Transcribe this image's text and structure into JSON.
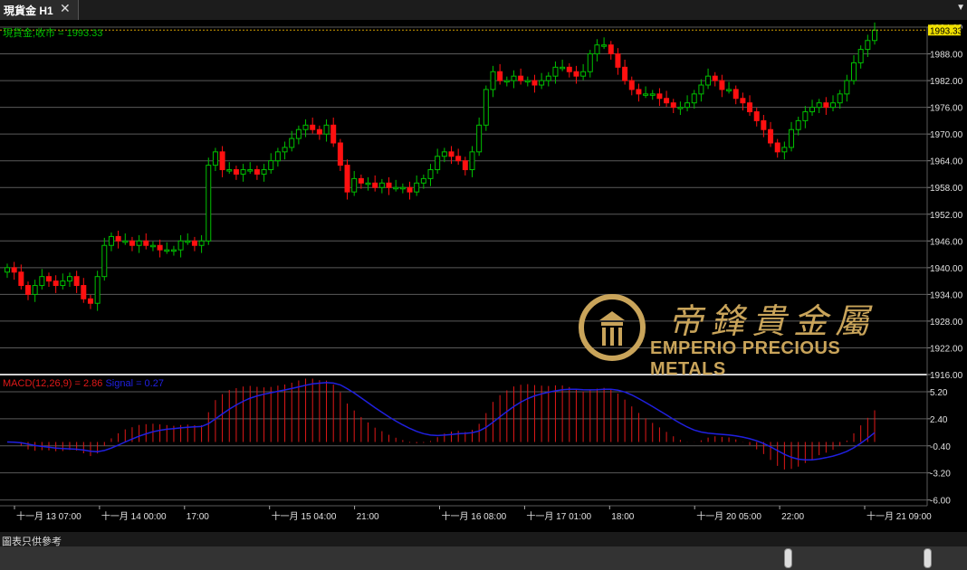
{
  "tab": {
    "title": "現貨金 H1",
    "close": "✕"
  },
  "price_label": "現貨金,收市 = 1993.33",
  "current_price": "1993.33",
  "macd_label": "MACD(12,26,9) = 2.86",
  "signal_label": "Signal = 0.27",
  "footer": {
    "disclaimer": "圖表只供參考"
  },
  "logo": {
    "cn": "帝鋒貴金屬",
    "en": "EMPERIO PRECIOUS METALS"
  },
  "colors": {
    "up": "#00c000",
    "down": "#ff1010",
    "macd_hist": "#e01818",
    "signal": "#2020e0",
    "grid": "#5a5a5a",
    "last_price": "#d4a000",
    "label_green": "#00c000",
    "price_tag_bg": "#f0e000"
  },
  "chart_data": [
    {
      "type": "candlestick",
      "name": "price",
      "ylim": [
        1916,
        1994
      ],
      "y_ticks": [
        "1994.00",
        "1988.00",
        "1982.00",
        "1976.00",
        "1970.00",
        "1964.00",
        "1958.00",
        "1952.00",
        "1946.00",
        "1940.00",
        "1934.00",
        "1928.00",
        "1922.00",
        "1916.00"
      ],
      "close": [
        1940,
        1939,
        1936,
        1934,
        1936,
        1938,
        1937,
        1936,
        1937,
        1938,
        1936,
        1933,
        1932,
        1938,
        1945,
        1947,
        1946,
        1946,
        1945,
        1946,
        1945,
        1945,
        1944,
        1944,
        1944,
        1946,
        1946,
        1945,
        1946,
        1963,
        1966,
        1962,
        1962,
        1961,
        1962,
        1962,
        1961,
        1962,
        1964,
        1966,
        1967,
        1969,
        1971,
        1972,
        1971,
        1970,
        1972,
        1968,
        1963,
        1957,
        1960,
        1959,
        1959,
        1958,
        1959,
        1958,
        1958,
        1958,
        1957,
        1959,
        1960,
        1962,
        1965,
        1966,
        1965,
        1964,
        1962,
        1966,
        1972,
        1980,
        1984,
        1982,
        1982,
        1983,
        1982,
        1982,
        1981,
        1982,
        1983,
        1985,
        1985,
        1984,
        1983,
        1984,
        1988,
        1990,
        1990,
        1988,
        1985,
        1982,
        1980,
        1979,
        1979,
        1979,
        1978,
        1977,
        1976,
        1976,
        1977,
        1979,
        1981,
        1983,
        1982,
        1980,
        1980,
        1978,
        1977,
        1975,
        1973,
        1971,
        1968,
        1966,
        1967,
        1971,
        1973,
        1975,
        1976,
        1977,
        1976,
        1977,
        1979,
        1982,
        1986,
        1989,
        1991,
        1993.33
      ],
      "x_labels": [
        "十一月 13 07:00",
        "十一月 14 00:00",
        "17:00",
        "十一月 15 04:00",
        "21:00",
        "十一月 16 08:00",
        "十一月 17 01:00",
        "18:00",
        "十一月 20 05:00",
        "22:00",
        "十一月 21 09:00"
      ]
    },
    {
      "type": "bar+line",
      "name": "macd",
      "ylim": [
        -6.6,
        6.6
      ],
      "y_ticks": [
        "5.20",
        "2.40",
        "-0.40",
        "-3.20",
        "-6.00"
      ]
    }
  ]
}
